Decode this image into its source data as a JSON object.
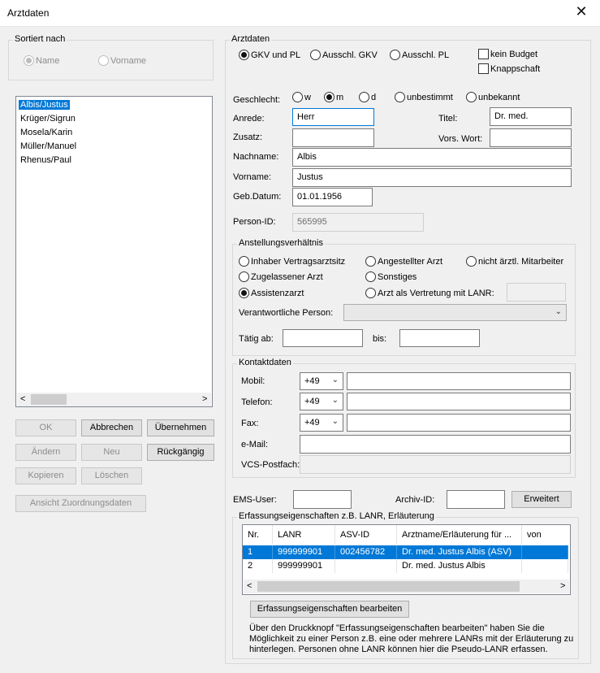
{
  "window": {
    "title": "Arztdaten",
    "close_glyph": "✕"
  },
  "sort": {
    "legend": "Sortiert nach",
    "options": [
      {
        "label": "Name",
        "selected": true
      },
      {
        "label": "Vorname",
        "selected": false
      }
    ]
  },
  "doctor_list": {
    "items": [
      "Albis/Justus",
      "Krüger/Sigrun",
      "Mosela/Karin",
      "Müller/Manuel",
      "Rhenus/Paul"
    ],
    "selected_index": 0,
    "scroll_left": "<",
    "scroll_right": ">"
  },
  "left_buttons": {
    "ok": "OK",
    "abbrechen": "Abbrechen",
    "uebernehmen": "Übernehmen",
    "aendern": "Ändern",
    "neu": "Neu",
    "rueckgaengig": "Rückgängig",
    "kopieren": "Kopieren",
    "loeschen": "Löschen",
    "ansicht": "Ansicht Zuordnungsdaten"
  },
  "arztdaten": {
    "legend": "Arztdaten",
    "billing": [
      {
        "label": "GKV und PL",
        "selected": true
      },
      {
        "label": "Ausschl. GKV",
        "selected": false
      },
      {
        "label": "Ausschl. PL",
        "selected": false
      }
    ],
    "checks": [
      {
        "label": "kein Budget",
        "checked": false
      },
      {
        "label": "Knappschaft",
        "checked": false
      }
    ],
    "gender": {
      "label": "Geschlecht:",
      "options": [
        {
          "label": "w",
          "selected": false
        },
        {
          "label": "m",
          "selected": true
        },
        {
          "label": "d",
          "selected": false
        },
        {
          "label": "unbestimmt",
          "selected": false
        },
        {
          "label": "unbekannt",
          "selected": false
        }
      ]
    },
    "fields": {
      "anrede": {
        "label": "Anrede:",
        "value": "Herr"
      },
      "titel": {
        "label": "Titel:",
        "value": "Dr. med."
      },
      "zusatz": {
        "label": "Zusatz:",
        "value": ""
      },
      "vorsatzwort": {
        "label": "Vors. Wort:",
        "value": ""
      },
      "nachname": {
        "label": "Nachname:",
        "value": "Albis"
      },
      "vorname": {
        "label": "Vorname:",
        "value": "Justus"
      },
      "gebdatum": {
        "label": "Geb.Datum:",
        "value": "01.01.1956"
      },
      "personid": {
        "label": "Person-ID:",
        "value": "565995"
      }
    }
  },
  "anstellung": {
    "legend": "Anstellungsverhältnis",
    "options": [
      {
        "label": "Inhaber Vertragsarztsitz",
        "selected": false
      },
      {
        "label": "Angestellter Arzt",
        "selected": false
      },
      {
        "label": "nicht ärztl. Mitarbeiter",
        "selected": false
      },
      {
        "label": "Zugelassener Arzt",
        "selected": false
      },
      {
        "label": "Sonstiges",
        "selected": false
      },
      {
        "label": "Assistenzarzt",
        "selected": true
      },
      {
        "label": "Arzt als Vertretung mit LANR:",
        "selected": false
      }
    ],
    "lanr_value": "",
    "verantwortlich_label": "Verantwortliche Person:",
    "verantwortlich_value": "",
    "taetig_ab_label": "Tätig ab:",
    "taetig_ab_value": "",
    "bis_label": "bis:",
    "bis_value": "",
    "dropdown_glyph": "⌄"
  },
  "kontakt": {
    "legend": "Kontaktdaten",
    "mobil": {
      "label": "Mobil:",
      "prefix": "+49",
      "value": ""
    },
    "telefon": {
      "label": "Telefon:",
      "prefix": "+49",
      "value": ""
    },
    "fax": {
      "label": "Fax:",
      "prefix": "+49",
      "value": ""
    },
    "email": {
      "label": "e-Mail:",
      "value": ""
    },
    "vcs": {
      "label": "VCS-Postfach:",
      "value": ""
    }
  },
  "misc": {
    "ems_label": "EMS-User:",
    "ems_value": "",
    "archiv_label": "Archiv-ID:",
    "archiv_value": "",
    "erweitert": "Erweitert"
  },
  "erfassung": {
    "legend": "Erfassungseigenschaften z.B. LANR, Erläuterung",
    "columns": [
      "Nr.",
      "LANR",
      "ASV-ID",
      "Arztname/Erläuterung für ...",
      "von"
    ],
    "rows": [
      [
        "1",
        "999999901",
        "002456782",
        "Dr. med. Justus Albis (ASV)",
        ""
      ],
      [
        "2",
        "999999901",
        "",
        "Dr. med. Justus Albis",
        ""
      ]
    ],
    "selected_row": 0,
    "button": "Erfassungseigenschaften  bearbeiten",
    "info_lines": [
      "Über den Druckknopf \"Erfassungseigenschaften bearbeiten\" haben Sie die",
      "Möglichkeit zu einer Person z.B. eine oder mehrere LANRs mit der Erläuterung zu",
      "hinterlegen. Personen ohne LANR können hier die Pseudo-LANR erfassen."
    ],
    "scroll_left": "<",
    "scroll_right": ">"
  }
}
